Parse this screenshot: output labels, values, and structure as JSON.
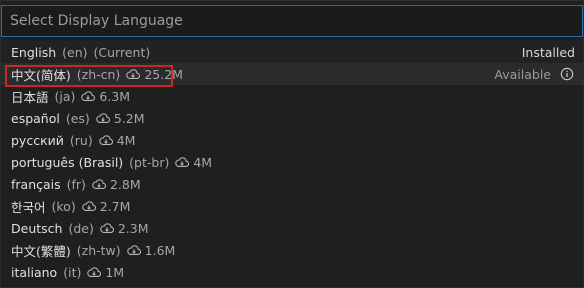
{
  "search": {
    "placeholder": "Select Display Language",
    "value": ""
  },
  "languages": [
    {
      "name": "English",
      "code": "(en)",
      "suffix": "(Current)",
      "status": "Installed"
    },
    {
      "name": "中文(简体)",
      "code": "(zh-cn)",
      "size": "25.2M",
      "status": "Available"
    },
    {
      "name": "日本語",
      "code": "(ja)",
      "size": "6.3M"
    },
    {
      "name": "español",
      "code": "(es)",
      "size": "5.2M"
    },
    {
      "name": "русский",
      "code": "(ru)",
      "size": "4M"
    },
    {
      "name": "português (Brasil)",
      "code": "(pt-br)",
      "size": "4M"
    },
    {
      "name": "français",
      "code": "(fr)",
      "size": "2.8M"
    },
    {
      "name": "한국어",
      "code": "(ko)",
      "size": "2.7M"
    },
    {
      "name": "Deutsch",
      "code": "(de)",
      "size": "2.3M"
    },
    {
      "name": "中文(繁體)",
      "code": "(zh-tw)",
      "size": "1.6M"
    },
    {
      "name": "italiano",
      "code": "(it)",
      "size": "1M"
    }
  ],
  "icons": {
    "cloud": "cloud-download-icon",
    "info": "info-icon"
  },
  "colors": {
    "highlight": "#c62828",
    "focus_border": "#2a67a8"
  }
}
